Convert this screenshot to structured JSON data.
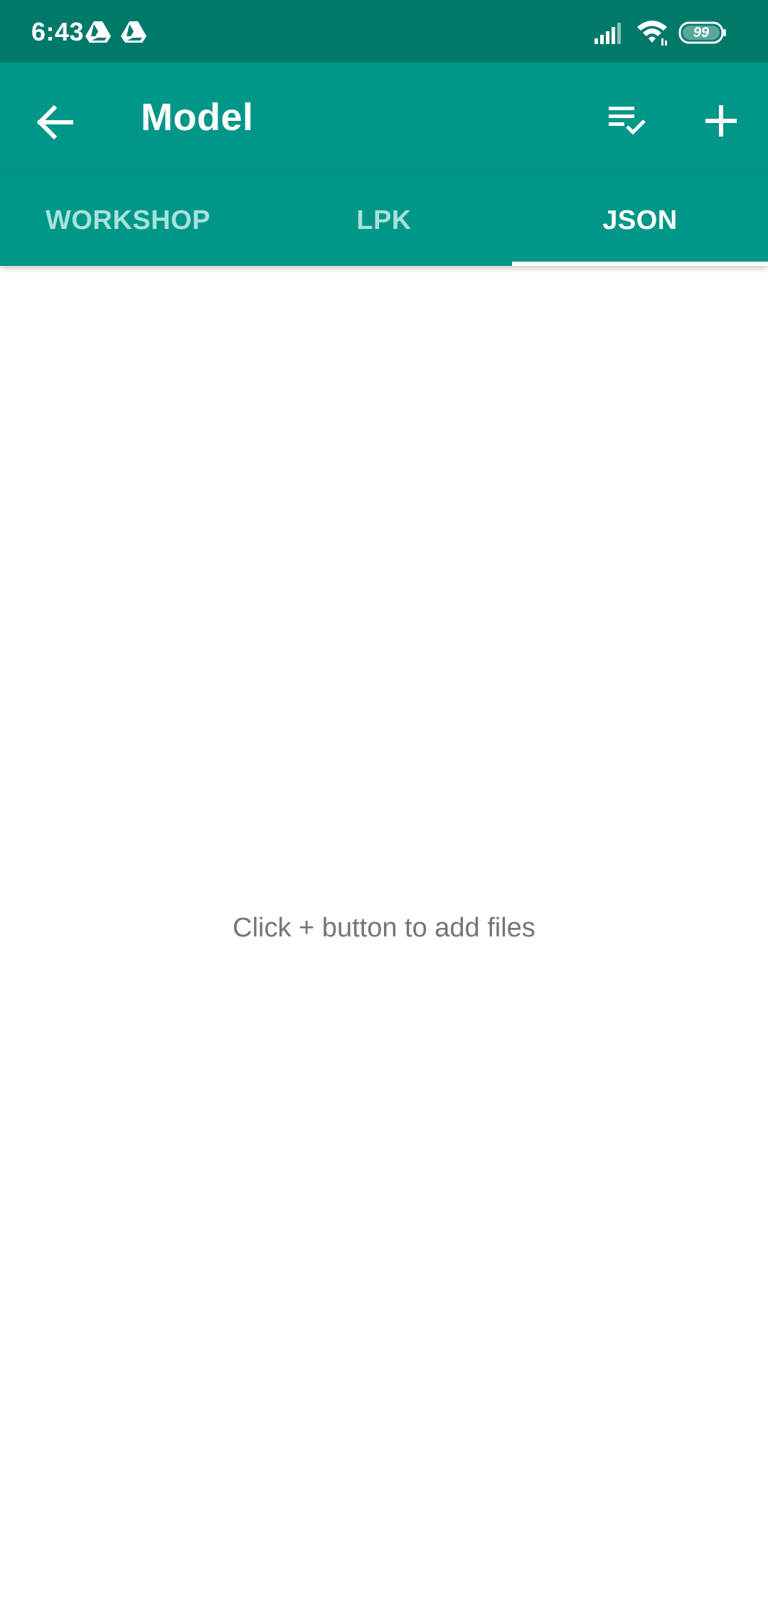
{
  "status_bar": {
    "time": "6:43",
    "notification_icons": [
      "drive-icon",
      "drive-icon"
    ],
    "signal_icon": "signal-icon",
    "wifi_icon": "wifi-icon",
    "battery_level": "99"
  },
  "app_bar": {
    "title": "Model",
    "back_icon": "arrow-back-icon",
    "select_icon": "playlist-check-icon",
    "add_icon": "plus-icon"
  },
  "tabs": [
    {
      "label": "WORKSHOP",
      "selected": false
    },
    {
      "label": "LPK",
      "selected": false
    },
    {
      "label": "JSON",
      "selected": true
    }
  ],
  "content": {
    "empty_message": "Click + button to add files"
  },
  "colors": {
    "status_bar": "#00796b",
    "primary": "#009688",
    "tab_inactive_text": "#a7e2db",
    "tab_active_text": "#ffffff",
    "empty_text": "#757575"
  }
}
